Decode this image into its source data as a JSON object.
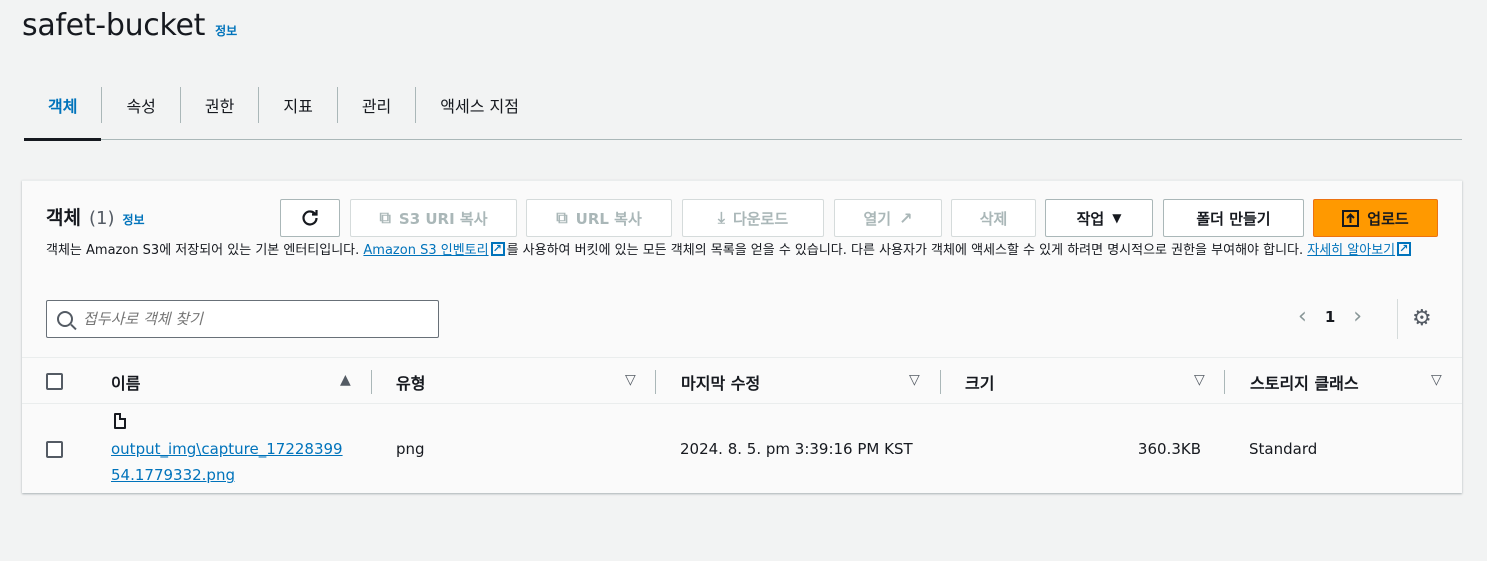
{
  "header": {
    "title": "safet-bucket",
    "info": "정보"
  },
  "tabs": [
    {
      "label": "객체",
      "active": true
    },
    {
      "label": "속성"
    },
    {
      "label": "권한"
    },
    {
      "label": "지표"
    },
    {
      "label": "관리"
    },
    {
      "label": "액세스 지점"
    }
  ],
  "panel": {
    "title": "객체",
    "count": "(1)",
    "info": "정보",
    "description_prefix": "객체는 Amazon S3에 저장되어 있는 기본 엔터티입니다. ",
    "inventory_link": "Amazon S3 인벤토리",
    "description_middle": "를 사용하여 버킷에 있는 모든 객체의 목록을 얻을 수 있습니다. 다른 사용자가 객체에 액세스할 수 있게 하려면 명시적으로 권한을 부여해야 합니다. ",
    "learn_more": "자세히 알아보기"
  },
  "toolbar": {
    "refresh_icon": "refresh-icon",
    "copy_s3_uri": "S3 URI 복사",
    "copy_url": "URL 복사",
    "download": "다운로드",
    "open": "열기",
    "delete": "삭제",
    "actions": "작업",
    "create_folder": "폴더 만들기",
    "upload": "업로드"
  },
  "search": {
    "placeholder": "접두사로 객체 찾기"
  },
  "pagination": {
    "page": "1"
  },
  "table": {
    "columns": [
      "이름",
      "유형",
      "마지막 수정",
      "크기",
      "스토리지 클래스"
    ],
    "rows": [
      {
        "name": "output_img\\capture_1722839954.1779332.png",
        "type": "png",
        "last_modified": "2024. 8. 5. pm 3:39:16 PM KST",
        "size": "360.3KB",
        "storage_class": "Standard"
      }
    ]
  },
  "colors": {
    "accent": "#0073bb",
    "primary_button": "#ff9900"
  }
}
